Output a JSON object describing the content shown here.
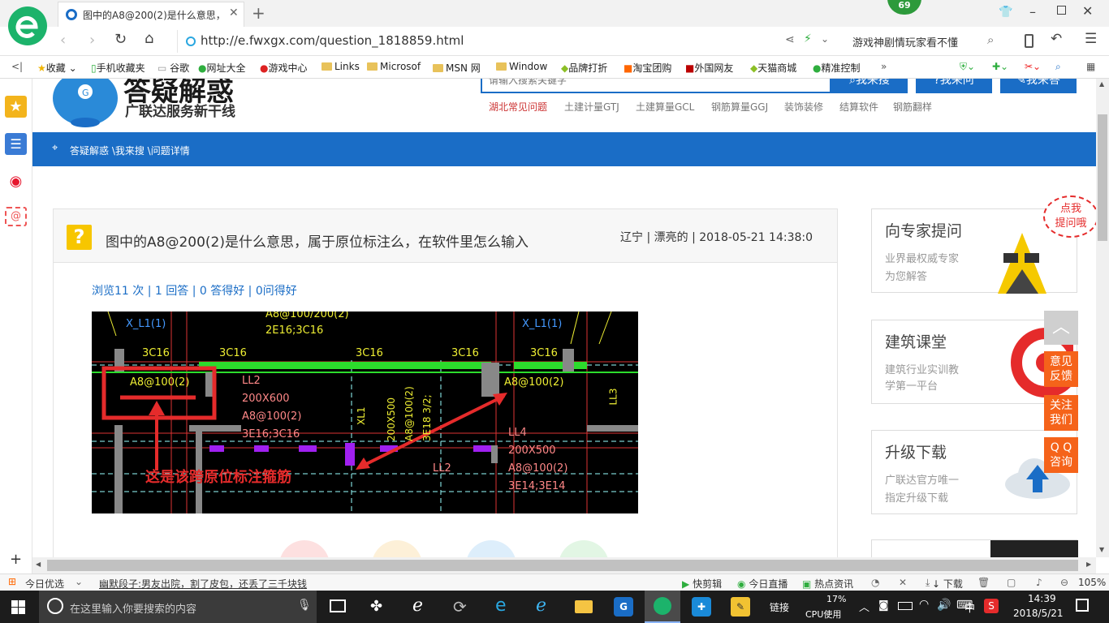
{
  "tab": {
    "title": "图中的A8@200(2)是什么意思，属",
    "badge": "69"
  },
  "nav": {
    "url": "http://e.fwxgx.com/question_1818859.html",
    "search_hint": "游戏神剧情玩家看不懂"
  },
  "favorites": [
    {
      "label": "收藏"
    },
    {
      "label": "手机收藏夹"
    },
    {
      "label": "谷歌"
    },
    {
      "label": "网址大全"
    },
    {
      "label": "游戏中心"
    },
    {
      "label": "Links"
    },
    {
      "label": "Microsof"
    },
    {
      "label": "MSN 网"
    },
    {
      "label": "Window"
    },
    {
      "label": "品牌打折"
    },
    {
      "label": "淘宝团购"
    },
    {
      "label": "外国网友"
    },
    {
      "label": "天猫商城"
    },
    {
      "label": "精准控制"
    }
  ],
  "site": {
    "logo_title": "答疑解惑",
    "logo_sub": "广联达服务新干线",
    "search_placeholder": "请输入搜索关键字",
    "search_btn": "我来搜",
    "ask_btn": "我来问",
    "answer_btn": "我来答",
    "categories": [
      "湖北常见问题",
      "土建计量GTJ",
      "土建算量GCL",
      "钢筋算量GGJ",
      "装饰装修",
      "结算软件",
      "钢筋翻样"
    ],
    "breadcrumb": "答疑解惑 \\我来搜 \\问题详情"
  },
  "question": {
    "title": "图中的A8@200(2)是什么意思，属于原位标注么，在软件里怎么输入",
    "meta": "辽宁 | 漂亮的 | 2018-05-21 14:38:0",
    "stats": "浏览11 次 | 1 回答 | 0 答得好 | 0问得好"
  },
  "cad": {
    "labels": [
      "X_L1(1)",
      "A8@100/200(2)",
      "2E16;3C16",
      "X_L1(1)",
      "3C16",
      "3C16",
      "3C16",
      "3C16",
      "3C16",
      "A8@100(2)",
      "LL2",
      "200X600",
      "A8@100(2)",
      "3E16;3C16",
      "A8@100(2)",
      "LL3",
      "LL4",
      "200X500",
      "A8@100(2)",
      "3E14;3E14",
      "LL2",
      "XL1",
      "200X500",
      "A8@100(2)",
      "3E18 3/2;"
    ],
    "annotation": "这是该跨原位标注箍筋"
  },
  "right": {
    "bubble": "点我\n提问哦",
    "cards": [
      {
        "title": "向专家提问",
        "line1": "业界最权威专家",
        "line2": "为您解答"
      },
      {
        "title": "建筑课堂",
        "line1": "建筑行业实训教",
        "line2": "学第一平台"
      },
      {
        "title": "升级下载",
        "line1": "广联达官方唯一",
        "line2": "指定升级下载"
      }
    ],
    "side_buttons": [
      "意见\n反馈",
      "关注\n我们",
      "Q Q\n咨询"
    ]
  },
  "status": {
    "left": "今日优选",
    "news": "幽默段子:男友出院，割了皮包，还丢了三千块钱",
    "items": [
      "快剪辑",
      "今日直播",
      "热点资讯",
      "下载"
    ],
    "zoom": "105%"
  },
  "taskbar": {
    "search_placeholder": "在这里输入你要搜索的内容",
    "links": "链接",
    "cpu_value": "17%",
    "cpu_label": "CPU使用",
    "ime": "中",
    "time": "14:39",
    "date": "2018/5/21"
  },
  "colors": {
    "accent": "#1a6dc6",
    "orange": "#f5631a",
    "red": "#e52b2b",
    "cad_bg": "#000000"
  }
}
